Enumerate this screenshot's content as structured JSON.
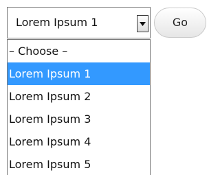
{
  "select": {
    "value": "Lorem Ipsum 1",
    "arrow_icon": "triangle-down-icon"
  },
  "go_button": {
    "label": "Go"
  },
  "dropdown": {
    "options": [
      {
        "label": "– Choose –"
      },
      {
        "label": "Lorem Ipsum 1",
        "selected": true
      },
      {
        "label": "Lorem Ipsum 2"
      },
      {
        "label": "Lorem Ipsum 3"
      },
      {
        "label": "Lorem Ipsum 4"
      },
      {
        "label": "Lorem Ipsum 5"
      }
    ]
  },
  "colors": {
    "highlight": "#3399ff",
    "highlight_text": "#ffffff",
    "border": "#7a7a7a"
  }
}
